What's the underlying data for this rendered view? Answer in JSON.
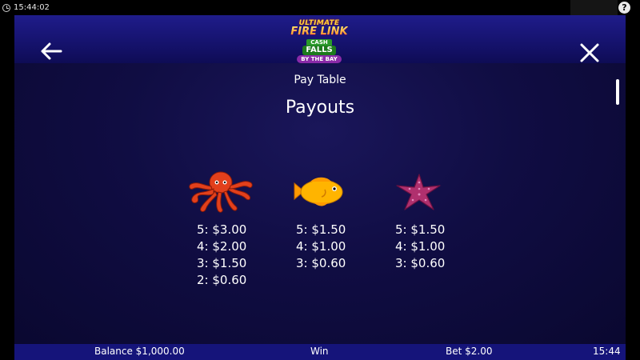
{
  "status_bar": {
    "time": "15:44:02",
    "help_icon": "help-icon",
    "help_glyph": "?"
  },
  "header": {
    "back_icon": "arrow-left-icon",
    "close_icon": "close-icon",
    "logo": {
      "line1": "ULTIMATE",
      "line2": "FIRE LINK",
      "line3": "CASH",
      "line4": "FALLS",
      "line5": "BY THE BAY"
    }
  },
  "page": {
    "section_label": "Pay Table",
    "title": "Payouts"
  },
  "paytable": [
    {
      "symbol": "octopus",
      "payouts": [
        "5: $3.00",
        "4: $2.00",
        "3: $1.50",
        "2: $0.60"
      ]
    },
    {
      "symbol": "fish",
      "payouts": [
        "5: $1.50",
        "4: $1.00",
        "3: $0.60"
      ]
    },
    {
      "symbol": "starfish",
      "payouts": [
        "5: $1.50",
        "4: $1.00",
        "3: $0.60"
      ]
    }
  ],
  "footer": {
    "balance": "Balance $1,000.00",
    "win": "Win",
    "bet": "Bet $2.00",
    "clock": "15:44"
  },
  "colors": {
    "header": "#1f1c8a",
    "background": "#100d43",
    "footer": "#15147a",
    "octopus": "#e2401c",
    "fish": "#ffb400",
    "starfish": "#b0306e"
  }
}
